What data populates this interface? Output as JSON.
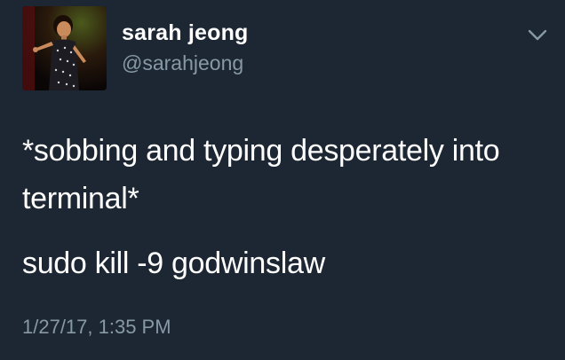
{
  "author": {
    "name": "sarah jeong",
    "handle": "@sarahjeong",
    "avatar_icon": "profile-photo"
  },
  "tweet": {
    "lines": [
      "*sobbing and typing desperately into terminal*",
      "sudo kill -9 godwinslaw"
    ],
    "timestamp": "1/27/17, 1:35 PM"
  },
  "menu": {
    "icon": "chevron-down-icon"
  },
  "colors": {
    "background": "#1c2733",
    "primary_text": "#ffffff",
    "secondary_text": "#8899a6"
  }
}
